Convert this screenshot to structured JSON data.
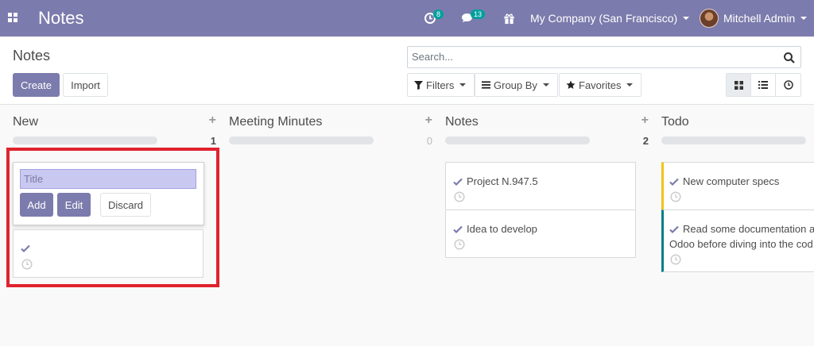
{
  "navbar": {
    "app_title": "Notes",
    "activity_count": "8",
    "messages_count": "13",
    "company": "My Company (San Francisco)",
    "user": "Mitchell Admin"
  },
  "control_panel": {
    "breadcrumb": "Notes",
    "create_label": "Create",
    "import_label": "Import",
    "search_placeholder": "Search...",
    "filters_label": "Filters",
    "group_by_label": "Group By",
    "favorites_label": "Favorites"
  },
  "columns": [
    {
      "title": "New",
      "count": "1"
    },
    {
      "title": "Meeting Minutes",
      "count": "0"
    },
    {
      "title": "Notes",
      "count": "2"
    },
    {
      "title": "Todo",
      "count": ""
    }
  ],
  "quick_create": {
    "title_placeholder": "Title",
    "add_label": "Add",
    "edit_label": "Edit",
    "discard_label": "Discard"
  },
  "cards": {
    "notes": [
      {
        "title": "Project N.947.5"
      },
      {
        "title": "Idea to develop"
      }
    ],
    "todo": [
      {
        "title": "New computer specs"
      },
      {
        "title_line1": "Read some documentation a",
        "title_line2": "Odoo before diving into the cod"
      }
    ]
  },
  "colors": {
    "brand": "#7c7bad",
    "badge": "#00a09d",
    "highlight": "#e0222e",
    "todo_stripe_1": "#f0c419",
    "todo_stripe_2": "#017e84"
  }
}
